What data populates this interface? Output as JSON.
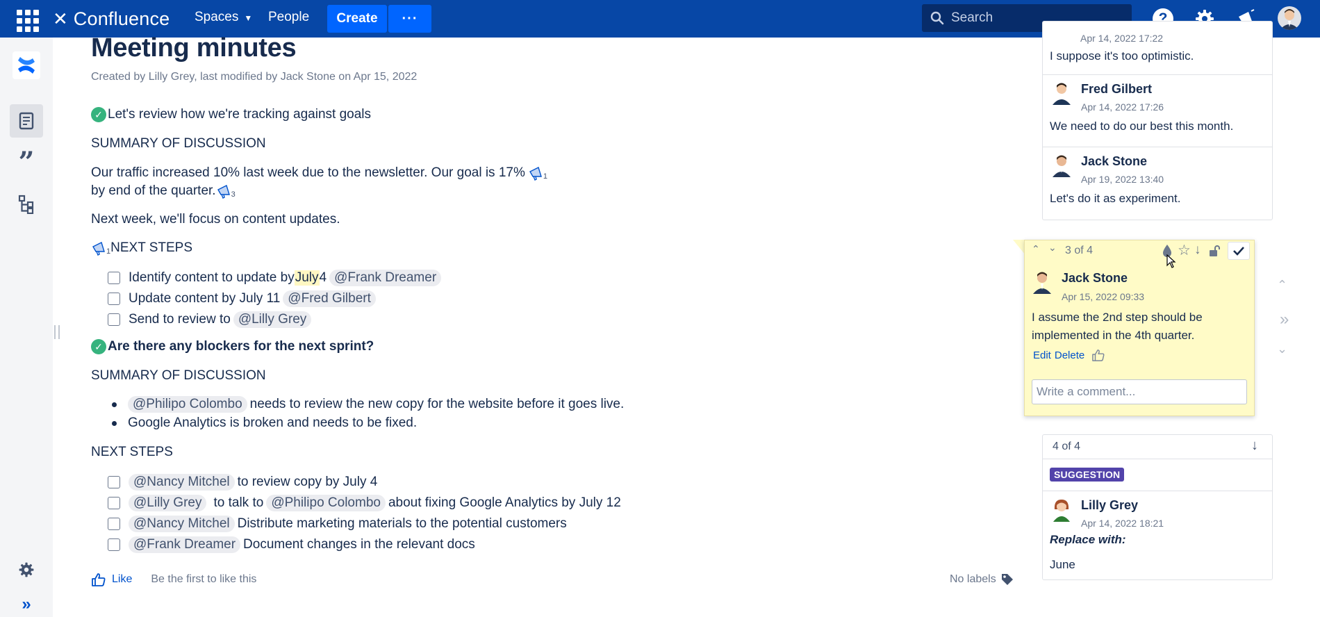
{
  "topnav": {
    "brand": "Confluence",
    "spaces": "Spaces",
    "people": "People",
    "create": "Create",
    "more": "···",
    "search_placeholder": "Search"
  },
  "page": {
    "title": "Meeting minutes",
    "byline": "Created by Lilly Grey, last modified by Jack Stone on Apr 15, 2022",
    "sections": {
      "s1_heading": "Let's review how we're tracking against goals",
      "s1_summary": "SUMMARY OF DISCUSSION",
      "s1_para1a": "Our traffic increased 10% last week due to the newsletter. Our goal is 17%",
      "s1_para1a_count": "1",
      "s1_para1b": "by end of the quarter.",
      "s1_para1b_count": "3",
      "s1_para2": "Next week, we'll focus on content updates.",
      "s1_next_count": "1",
      "s1_next": "NEXT STEPS",
      "s1_tasks": [
        {
          "pre": "Identify content to update by ",
          "hl": "July",
          "post": " 4",
          "mention": "@Frank Dreamer"
        },
        {
          "pre": "Update content by July 11",
          "mention": "@Fred Gilbert"
        },
        {
          "pre": "Send to review to",
          "mention": "@Lilly Grey"
        }
      ],
      "s2_heading": "Are there any blockers for the next sprint?",
      "s2_summary": "SUMMARY OF DISCUSSION",
      "s2_bullets": [
        {
          "mention": "@Philipo Colombo",
          "text": "needs to review the new copy for the website before it goes live."
        },
        {
          "text": "Google Analytics is broken and needs to be fixed."
        }
      ],
      "s2_next": "NEXT STEPS",
      "s2_tasks": [
        {
          "mention": "@Nancy Mitchel",
          "text": "to review copy by July 4"
        },
        {
          "mention": "@Lilly Grey",
          "text": "to talk to",
          "mention2": "@Philipo Colombo",
          "text2": "about fixing Google Analytics by July 12"
        },
        {
          "mention": "@Nancy Mitchel",
          "text": "Distribute marketing materials to the potential customers"
        },
        {
          "mention": "@Frank Dreamer",
          "text": "Document changes in the relevant docs"
        }
      ]
    },
    "like": "Like",
    "like_note": "Be the first to like this",
    "no_labels": "No labels"
  },
  "comments": {
    "top_card": {
      "partial_date": "Apr 14, 2022 17:22",
      "partial_text": "I suppose it's too optimistic.",
      "items": [
        {
          "name": "Fred Gilbert",
          "date": "Apr 14, 2022 17:26",
          "text": "We need to do our best this month."
        },
        {
          "name": "Jack Stone",
          "date": "Apr 19, 2022 13:40",
          "text": "Let's do it as experiment."
        }
      ]
    },
    "active": {
      "counter": "3 of 4",
      "name": "Jack Stone",
      "date": "Apr 15, 2022 09:33",
      "text_line1": "I assume the 2nd step should be",
      "text_line2": "implemented in the 4th quarter.",
      "edit": "Edit",
      "delete": "Delete",
      "input_placeholder": "Write a comment..."
    },
    "suggestion": {
      "counter": "4 of 4",
      "badge": "SUGGESTION",
      "name": "Lilly Grey",
      "date": "Apr 14, 2022 18:21",
      "replace_label": "Replace with:",
      "replacement": "June"
    }
  },
  "colors": {
    "nav": "#0747a6",
    "create": "#0065ff",
    "comment_highlight": "#fffbc7",
    "badge": "#5243aa",
    "done": "#36b37e"
  }
}
